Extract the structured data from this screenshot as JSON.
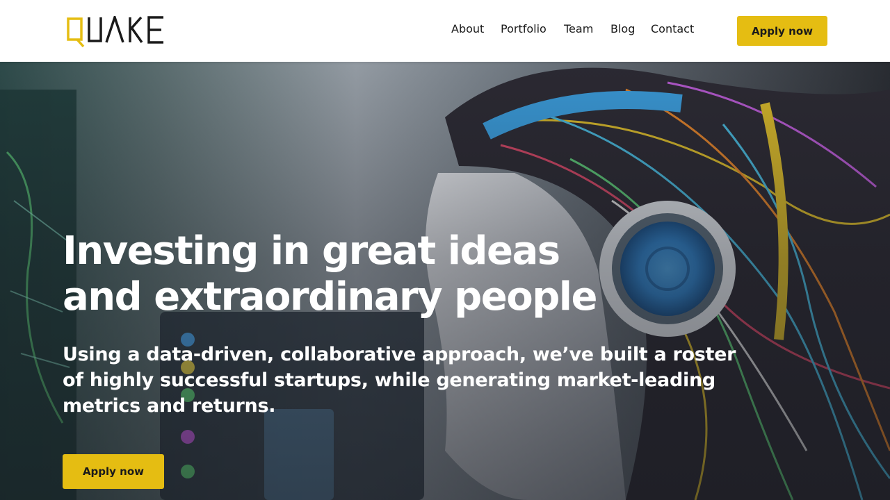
{
  "brand": {
    "name": "QUAKE",
    "accent_color": "#e5bd12",
    "text_color": "#1a1a1a"
  },
  "nav": {
    "items": [
      {
        "label": "About"
      },
      {
        "label": "Portfolio"
      },
      {
        "label": "Team"
      },
      {
        "label": "Blog"
      },
      {
        "label": "Contact"
      }
    ],
    "cta_label": "Apply now"
  },
  "hero": {
    "title": "Investing in great ideas and extraordinary people",
    "subtitle": "Using a data-driven, collaborative approach, we’ve built a roster of highly successful startups, while generating market-leading metrics and returns.",
    "cta_label": "Apply now",
    "background_image": "robot-head-with-headphones-and-colorful-wires"
  }
}
